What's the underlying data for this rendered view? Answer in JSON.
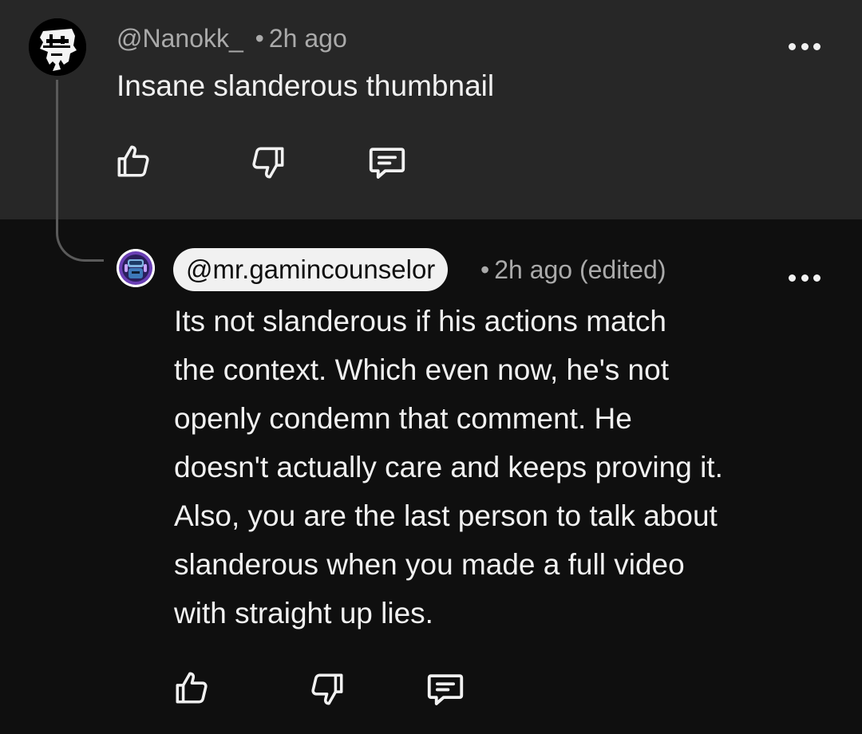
{
  "parent_comment": {
    "author": "@Nanokk_",
    "separator": "•",
    "time": "2h ago",
    "text": "Insane slanderous thumbnail",
    "avatar_icon": "skull-avatar-icon",
    "menu_icon": "more-vert-icon"
  },
  "reply_comment": {
    "author": "@mr.gamincounselor",
    "separator": "•",
    "time": "2h ago (edited)",
    "lines": [
      "Its not slanderous if his actions match",
      "the context. Which even now, he's not",
      "openly condemn that comment. He",
      "doesn't actually care and keeps proving it.",
      "Also, you are the last person to talk about",
      "slanderous when you made a full video",
      "with straight up lies."
    ],
    "avatar_icon": "robot-avatar-icon",
    "menu_icon": "more-vert-icon"
  },
  "actions": {
    "like_icon": "thumbs-up-icon",
    "dislike_icon": "thumbs-down-icon",
    "reply_icon": "comment-reply-icon"
  },
  "colors": {
    "parent_bg": "#272727",
    "reply_bg": "#0f0f0f",
    "text_primary": "#f1f1f1",
    "text_secondary": "#aaaaaa",
    "chip_bg": "#f1f1f1"
  }
}
